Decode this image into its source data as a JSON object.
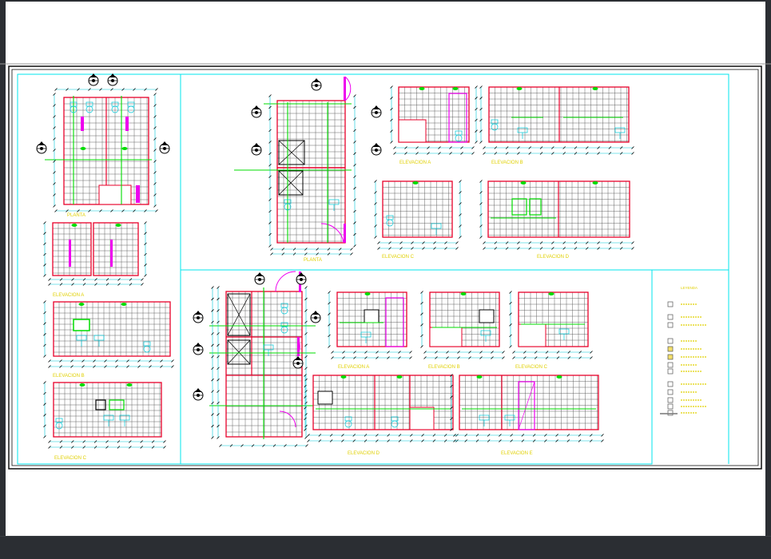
{
  "sheet": {
    "plan_label": "PLANTA",
    "floor_plan_label": "PLANTA",
    "elev_a": "ELEVACION A",
    "elev_b": "ELEVACION B",
    "elev_c": "ELEVACION C",
    "elev_d": "ELEVACION D",
    "elev_e": "ELEVACION E",
    "legend_title": "LEYENDA"
  },
  "colors": {
    "frame": "#111111",
    "viewport": "#00e5ee",
    "tile": "#555555",
    "wall": "#e8002a",
    "dim": "#00c8d8",
    "green": "#00dd00",
    "magenta": "#ee00ee",
    "yellow": "#e0d000",
    "taskbar": "#2b2e33"
  },
  "icons": [
    "section-marker-icon",
    "door-swing-icon",
    "toilet-icon",
    "sink-icon",
    "shower-icon"
  ]
}
